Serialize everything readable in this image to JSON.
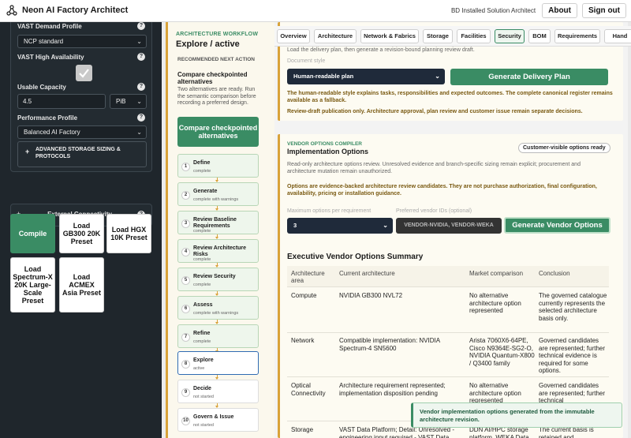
{
  "header": {
    "title": "Neon AI Factory Architect",
    "subtitle": "BD Installed Solution Architect",
    "about_label": "About",
    "signout_label": "Sign out"
  },
  "sidebar": {
    "demand_label": "VAST Demand Profile",
    "demand_value": "NCP standard",
    "ha_label": "VAST High Availability",
    "capacity_label": "Usable Capacity",
    "capacity_value": "4.5",
    "capacity_unit": "PiB",
    "perf_label": "Performance Profile",
    "perf_value": "Balanced AI Factory",
    "advanced_label": "ADVANCED STORAGE SIZING & PROTOCOLS",
    "external_label": "External Connectivity",
    "presets": [
      "Compile",
      "Load GB300 20K Preset",
      "Load HGX 10K Preset",
      "Load Spectrum-X 20K Large-Scale Preset",
      "Load ACMEX Asia Preset"
    ]
  },
  "workflow": {
    "eyebrow": "ARCHITECTURE WORKFLOW",
    "title": "Explore / active",
    "rec_label": "RECOMMENDED NEXT ACTION",
    "rec_title": "Compare checkpointed alternatives",
    "rec_desc": "Two alternatives are ready. Run the semantic comparison before recording a preferred design.",
    "cta_label": "Compare checkpointed alternatives",
    "steps": [
      {
        "num": "1",
        "title": "Define",
        "status": "complete"
      },
      {
        "num": "2",
        "title": "Generate",
        "status": "complete with warnings"
      },
      {
        "num": "3",
        "title": "Review Baseline Requirements",
        "status": "complete"
      },
      {
        "num": "4",
        "title": "Review Architecture Risks",
        "status": "complete"
      },
      {
        "num": "5",
        "title": "Review Security",
        "status": "complete"
      },
      {
        "num": "6",
        "title": "Assess",
        "status": "complete with warnings"
      },
      {
        "num": "7",
        "title": "Refine",
        "status": "complete"
      },
      {
        "num": "8",
        "title": "Explore",
        "status": "active"
      },
      {
        "num": "9",
        "title": "Decide",
        "status": "not started"
      },
      {
        "num": "10",
        "title": "Govern & Issue",
        "status": "not started"
      }
    ]
  },
  "tabs": [
    "Overview",
    "Architecture",
    "Network & Fabrics",
    "Storage",
    "Facilities",
    "Security",
    "BOM",
    "Requirements",
    "Hand"
  ],
  "delivery": {
    "intro": "Load the delivery plan, then generate a revision-bound planning review draft.",
    "doc_style_label": "Document style",
    "doc_style_value": "Human-readable plan",
    "generate_label": "Generate Delivery Plan",
    "note1": "The human-readable style explains tasks, responsibilities and expected outcomes. The complete canonical register remains available as a fallback.",
    "note2": "Review-draft publication only. Architecture approval, plan review and customer issue remain separate decisions."
  },
  "vendor": {
    "eyebrow": "VENDOR OPTIONS COMPILER",
    "title": "Implementation Options",
    "pill": "Customer-visible options ready",
    "intro": "Read-only architecture options review. Unresolved evidence and branch-specific sizing remain explicit; procurement and architecture mutation remain unauthorized.",
    "note": "Options are evidence-backed architecture review candidates. They are not purchase authorization, final configuration, availability, pricing or installation guidance.",
    "max_label": "Maximum options per requirement",
    "max_value": "3",
    "pref_label": "Preferred vendor IDs (optional)",
    "pref_placeholder": "VENDOR-NVIDIA, VENDOR-WEKA",
    "generate_label": "Generate Vendor Options",
    "summary_title": "Executive Vendor Options Summary",
    "columns": [
      "Architecture area",
      "Current architecture",
      "Market comparison",
      "Conclusion"
    ],
    "rows": [
      {
        "area": "Compute",
        "current": "NVIDIA GB300 NVL72",
        "market": "No alternative architecture option represented",
        "conclusion": "The governed catalogue currently represents the selected architecture basis only."
      },
      {
        "area": "Network",
        "current": "Compatible implementation: NVIDIA Spectrum-4 SN5600",
        "market": "Arista 7060X6-64PE, Cisco N9364E-SG2-O, NVIDIA Quantum-X800 / Q3400 family",
        "conclusion": "Governed candidates are represented; further technical evidence is required for some options."
      },
      {
        "area": "Optical Connectivity",
        "current": "Architecture requirement represented; implementation disposition pending",
        "market": "No alternative architecture option represented",
        "conclusion": "Governed candidates are represented; further technical"
      },
      {
        "area": "Storage",
        "current": "VAST Data Platform; Detail: Unresolved - engineering input required - VAST Data",
        "market": "DDN AI/HPC storage platform, WEKA Data",
        "conclusion": "The current basis is retained and"
      }
    ]
  },
  "toast": "Vendor implementation options generated from the immutable architecture revision."
}
